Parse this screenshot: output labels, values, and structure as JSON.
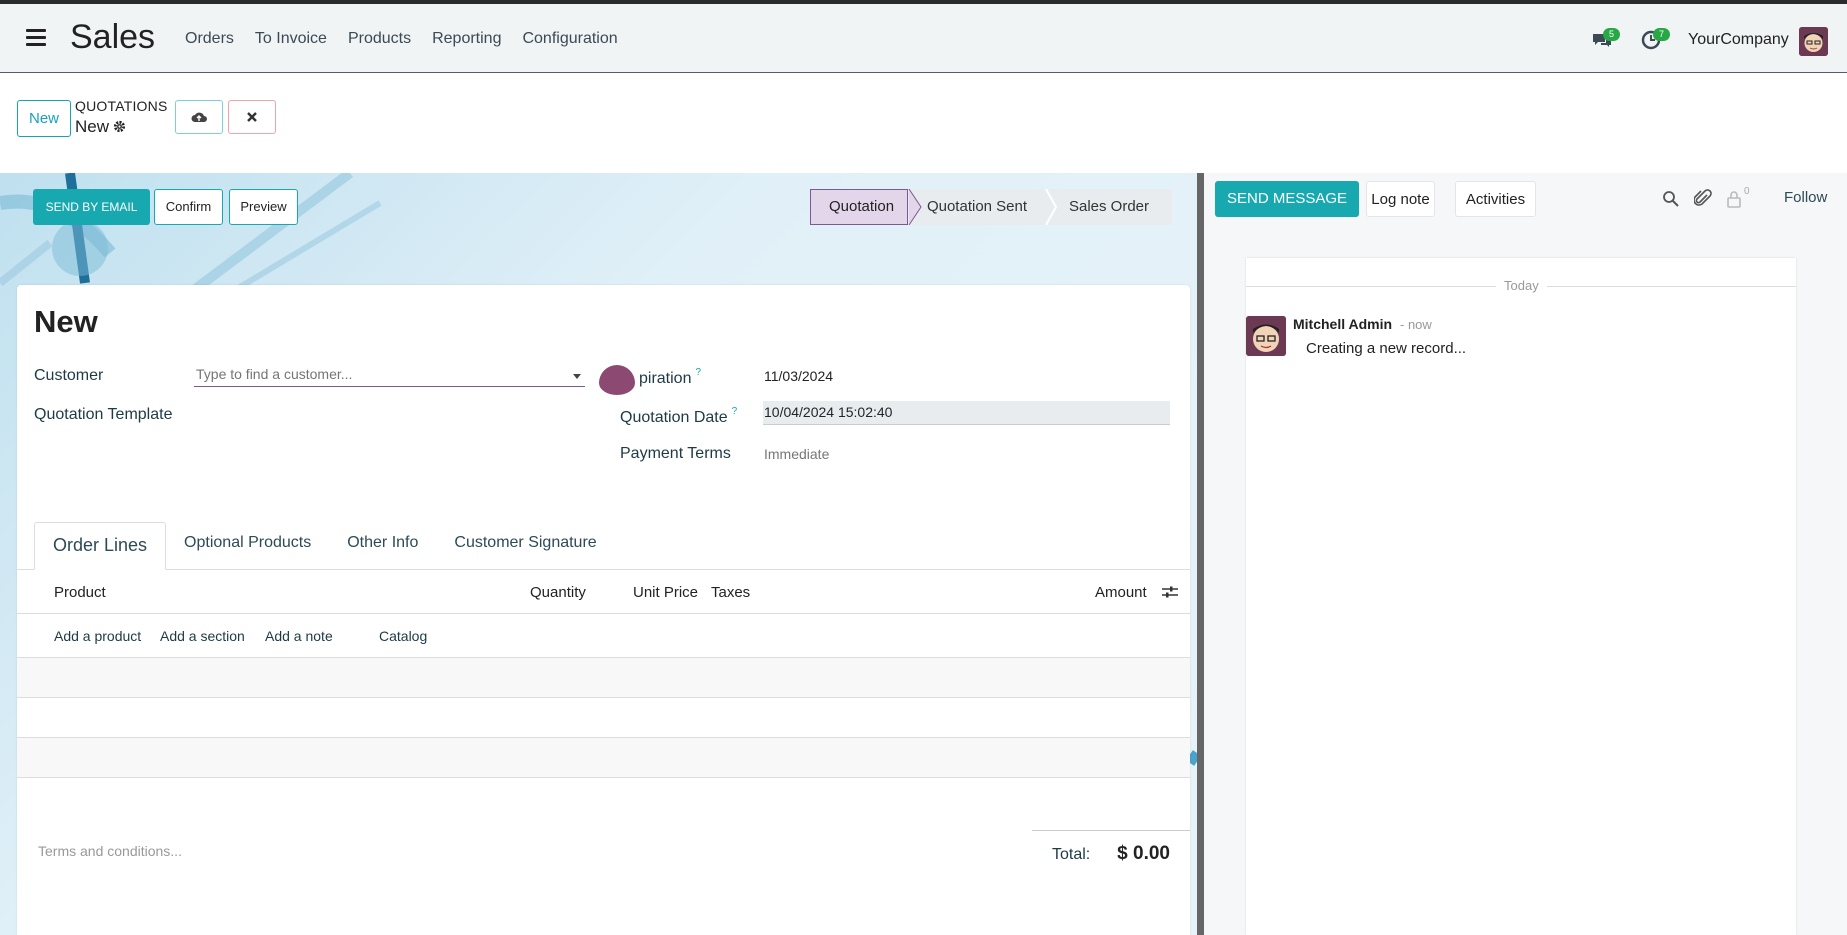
{
  "topbar": {
    "app_title": "Sales",
    "menu": [
      "Orders",
      "To Invoice",
      "Products",
      "Reporting",
      "Configuration"
    ],
    "messages_badge": "5",
    "activities_badge": "7",
    "company": "YourCompany"
  },
  "control": {
    "new_label": "New",
    "breadcrumb_parent": "QUOTATIONS",
    "breadcrumb_current": "New"
  },
  "statusbar": {
    "send_email": "SEND BY EMAIL",
    "confirm": "Confirm",
    "preview": "Preview",
    "stages": [
      "Quotation",
      "Quotation Sent",
      "Sales Order"
    ],
    "active_stage": "Quotation"
  },
  "form": {
    "title": "New",
    "customer_label": "Customer",
    "customer_placeholder": "Type to find a customer...",
    "template_label": "Quotation Template",
    "expiration_label": "piration",
    "expiration_value": "11/03/2024",
    "qdate_label": "Quotation Date",
    "qdate_value": "10/04/2024 15:02:40",
    "payment_label": "Payment Terms",
    "payment_value": "Immediate",
    "help_mark": "?"
  },
  "tabs": [
    "Order Lines",
    "Optional Products",
    "Other Info",
    "Customer Signature"
  ],
  "table": {
    "headers": {
      "product": "Product",
      "quantity": "Quantity",
      "unit_price": "Unit Price",
      "taxes": "Taxes",
      "amount": "Amount"
    },
    "add_product": "Add a product",
    "add_section": "Add a section",
    "add_note": "Add a note",
    "catalog": "Catalog"
  },
  "footer": {
    "terms_placeholder": "Terms and conditions...",
    "total_label": "Total:",
    "total_value": "$ 0.00"
  },
  "chatter": {
    "send_message": "SEND MESSAGE",
    "log_note": "Log note",
    "activities": "Activities",
    "followers_count": "0",
    "follow": "Follow",
    "day_separator": "Today",
    "author": "Mitchell Admin",
    "timestamp": "- now",
    "message": "Creating a new record..."
  },
  "colors": {
    "primary": "#17a8b0",
    "brand_purple": "#7b5b8f",
    "badge_green": "#28a745"
  }
}
